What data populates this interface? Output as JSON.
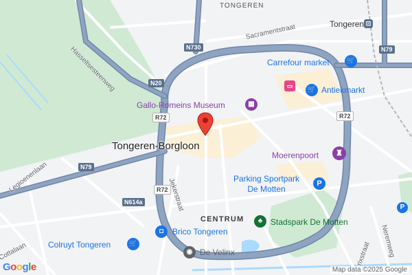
{
  "labels": {
    "city": "Tongeren-Borgloon",
    "district": "CENTRUM",
    "town_top": "TONGEREN",
    "station": "Tongeren",
    "museum": "Gallo-Romeins Museum",
    "carrefour": "Carrefour market",
    "antiekmarkt": "Antiekmarkt",
    "moerenpoort": "Moerenpoort",
    "parking": "Parking Sportpark\nDe Motten",
    "stadspark": "Stadspark De Motten",
    "brico": "Brico Tongeren",
    "colruyt": "Colruyt Tongeren",
    "velinx": "De Velinx"
  },
  "streets": {
    "hasseltsesteenweg": "Hasseltsesteenweg",
    "sacramentstraat": "Sacramentstraat",
    "legioenenlaan": "Legioenenlaan",
    "jekerstraat": "Jekerstraat",
    "cottalaan": "Cottalaan",
    "nerenweg": "Neremweg",
    "partial_straat": "rixstraat"
  },
  "shields": {
    "n730": "N730",
    "n20": "N20",
    "r72_a": "R72",
    "r72_b": "R72",
    "r72_c": "R72",
    "n79_a": "N79",
    "n79_b": "N79",
    "n614a": "N614a"
  },
  "footer": {
    "logo": "Google",
    "attribution": "Map data ©2025 Google"
  },
  "colors": {
    "background": "#f2f3f5",
    "major_road": "#8fa4c1",
    "major_road_casing": "#6f86a8",
    "minor_road": "#ffffff",
    "park": "#cfe9d3",
    "water": "#aadaff",
    "commercial": "#fbefd6",
    "marker": "#ea4335",
    "poi_purple": "#8a3fa8",
    "poi_blue": "#1a73e8",
    "poi_green": "#137333",
    "poi_gray": "#5f6368"
  },
  "icons": {
    "marker": "location-pin-icon",
    "museum": "museum-icon",
    "carrefour": "shopping-cart-icon",
    "antiekmarkt": "shopping-cart-icon",
    "moerenpoort": "castle-icon",
    "parking": "parking-icon",
    "stadspark": "tree-icon",
    "brico": "shopping-bag-icon",
    "colruyt": "shopping-cart-icon",
    "velinx": "venue-icon",
    "hotel": "bed-icon",
    "station": "train-icon"
  }
}
